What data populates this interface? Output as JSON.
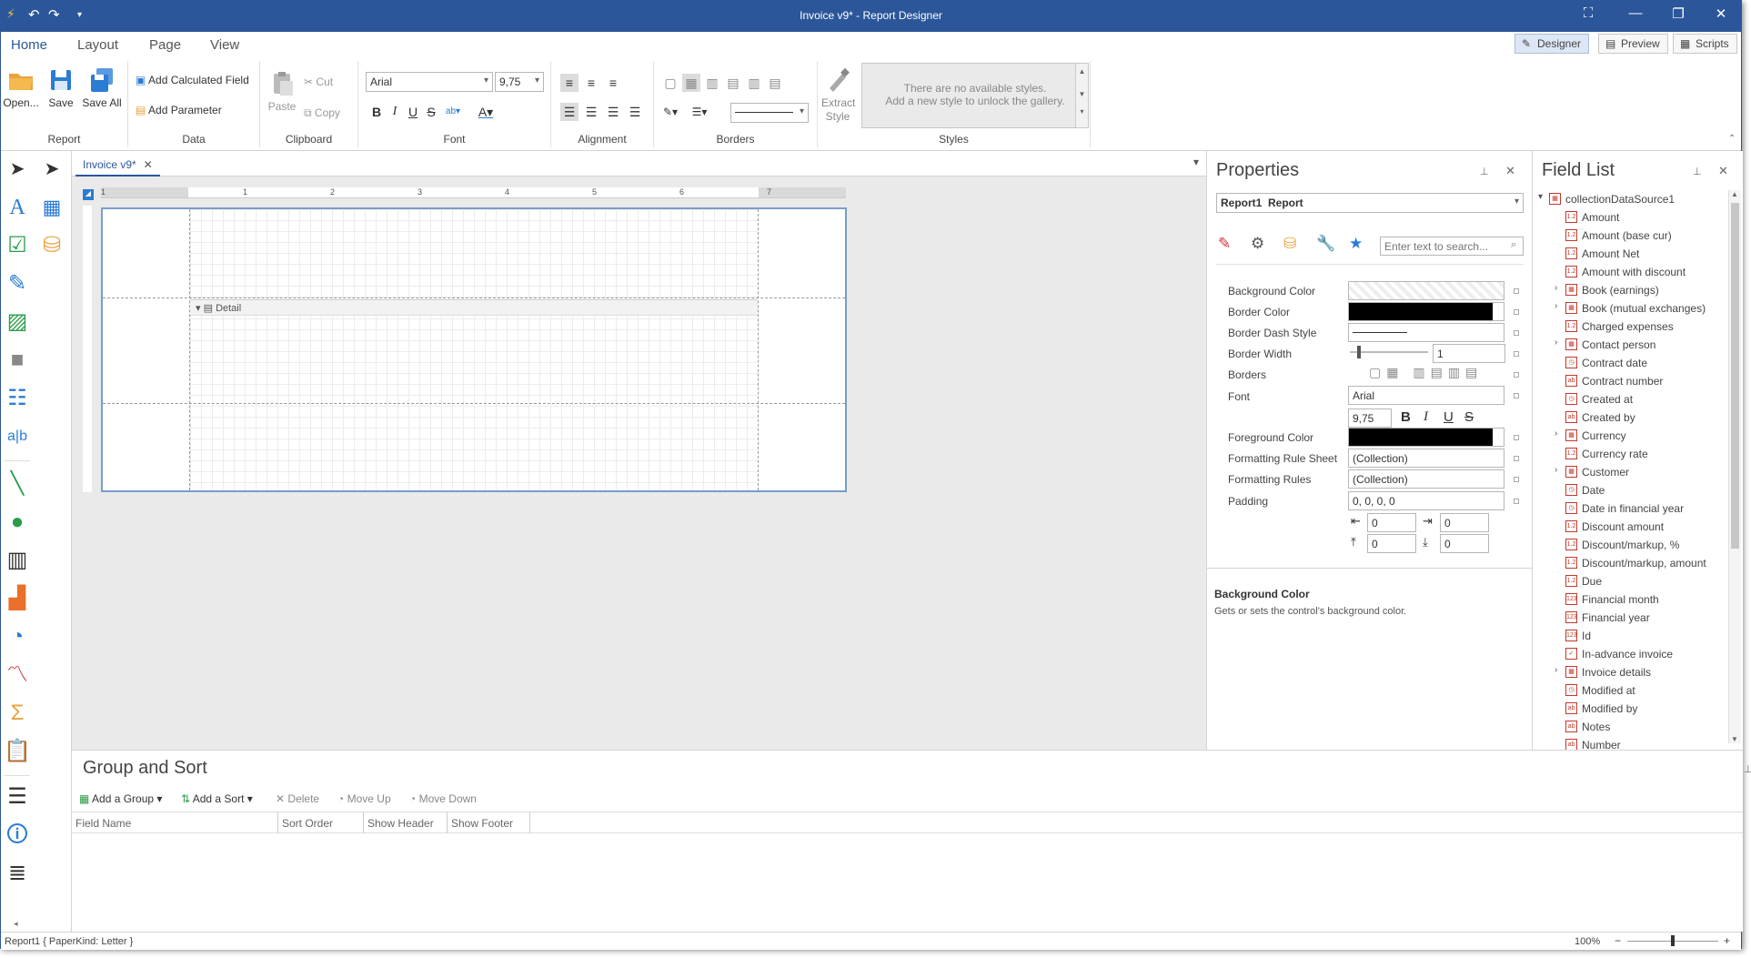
{
  "window": {
    "title": "Invoice v9* - Report Designer"
  },
  "ribbon": {
    "tabs": [
      "Home",
      "Layout",
      "Page",
      "View"
    ],
    "modes": [
      "Designer",
      "Preview",
      "Scripts"
    ],
    "groups": {
      "report": {
        "label": "Report",
        "open": "Open...",
        "save": "Save",
        "save_all": "Save All"
      },
      "data": {
        "label": "Data",
        "add_calculated_field": "Add Calculated Field",
        "add_parameter": "Add Parameter"
      },
      "clipboard": {
        "label": "Clipboard",
        "paste": "Paste",
        "cut": "Cut",
        "copy": "Copy"
      },
      "font": {
        "label": "Font",
        "family": "Arial",
        "size": "9,75"
      },
      "alignment": {
        "label": "Alignment"
      },
      "borders": {
        "label": "Borders"
      },
      "styles": {
        "label": "Styles",
        "extract_style": "Extract Style",
        "empty_line1": "There are no available styles.",
        "empty_line2": "Add a new style to unlock the gallery."
      }
    }
  },
  "document": {
    "tab": "Invoice v9*",
    "ruler_marks": [
      "1",
      "2",
      "3",
      "4",
      "5",
      "6",
      "7"
    ],
    "band_label": "Detail"
  },
  "properties": {
    "title": "Properties",
    "selector": {
      "name": "Report1",
      "type": "Report"
    },
    "search_placeholder": "Enter text to search...",
    "rows": {
      "background_color": "Background Color",
      "border_color": "Border Color",
      "border_dash_style": "Border Dash Style",
      "border_width": "Border Width",
      "border_width_value": "1",
      "borders": "Borders",
      "font": "Font",
      "font_family": "Arial",
      "font_size": "9,75",
      "foreground_color": "Foreground Color",
      "formatting_rule_sheet": "Formatting Rule Sheet",
      "formatting_rule_sheet_value": "(Collection)",
      "formatting_rules": "Formatting Rules",
      "formatting_rules_value": "(Collection)",
      "padding": "Padding",
      "padding_value": "0, 0, 0, 0",
      "pad_left": "0",
      "pad_right": "0",
      "pad_top": "0",
      "pad_bottom": "0"
    },
    "description": {
      "title": "Background Color",
      "text": "Gets or sets the control's background color."
    }
  },
  "field_list": {
    "title": "Field List",
    "root": "collectionDataSource1",
    "items": [
      {
        "label": "Amount",
        "icon": "1.2",
        "expandable": false
      },
      {
        "label": "Amount (base cur)",
        "icon": "1.2",
        "expandable": false
      },
      {
        "label": "Amount Net",
        "icon": "1.2",
        "expandable": false
      },
      {
        "label": "Amount with discount",
        "icon": "1.2",
        "expandable": false
      },
      {
        "label": "Book (earnings)",
        "icon": "tbl",
        "expandable": true
      },
      {
        "label": "Book (mutual exchanges)",
        "icon": "tbl",
        "expandable": true
      },
      {
        "label": "Charged expenses",
        "icon": "1.2",
        "expandable": false
      },
      {
        "label": "Contact person",
        "icon": "tbl",
        "expandable": true
      },
      {
        "label": "Contract date",
        "icon": "clk",
        "expandable": false
      },
      {
        "label": "Contract number",
        "icon": "ab",
        "expandable": false
      },
      {
        "label": "Created at",
        "icon": "clk",
        "expandable": false
      },
      {
        "label": "Created by",
        "icon": "ab",
        "expandable": false
      },
      {
        "label": "Currency",
        "icon": "tbl",
        "expandable": true
      },
      {
        "label": "Currency rate",
        "icon": "1.2",
        "expandable": false
      },
      {
        "label": "Customer",
        "icon": "tbl",
        "expandable": true
      },
      {
        "label": "Date",
        "icon": "clk",
        "expandable": false
      },
      {
        "label": "Date in financial year",
        "icon": "clk",
        "expandable": false
      },
      {
        "label": "Discount amount",
        "icon": "1.2",
        "expandable": false
      },
      {
        "label": "Discount/markup, %",
        "icon": "1.2",
        "expandable": false
      },
      {
        "label": "Discount/markup, amount",
        "icon": "1.2",
        "expandable": false
      },
      {
        "label": "Due",
        "icon": "1.2",
        "expandable": false
      },
      {
        "label": "Financial month",
        "icon": "123",
        "expandable": false
      },
      {
        "label": "Financial year",
        "icon": "123",
        "expandable": false
      },
      {
        "label": "Id",
        "icon": "123",
        "expandable": false
      },
      {
        "label": "In-advance invoice",
        "icon": "chk",
        "expandable": false
      },
      {
        "label": "Invoice details",
        "icon": "tbl",
        "expandable": true
      },
      {
        "label": "Modified at",
        "icon": "clk",
        "expandable": false
      },
      {
        "label": "Modified by",
        "icon": "ab",
        "expandable": false
      },
      {
        "label": "Notes",
        "icon": "ab",
        "expandable": false
      },
      {
        "label": "Number",
        "icon": "ab",
        "expandable": false
      }
    ]
  },
  "group_sort": {
    "title": "Group and Sort",
    "buttons": {
      "add_group": "Add a Group",
      "add_sort": "Add a Sort",
      "delete": "Delete",
      "move_up": "Move Up",
      "move_down": "Move Down"
    },
    "columns": [
      "Field Name",
      "Sort Order",
      "Show Header",
      "Show Footer"
    ]
  },
  "status": {
    "left": "Report1 { PaperKind: Letter }",
    "zoom": "100%"
  },
  "colors": {
    "accent": "#2b579a"
  }
}
